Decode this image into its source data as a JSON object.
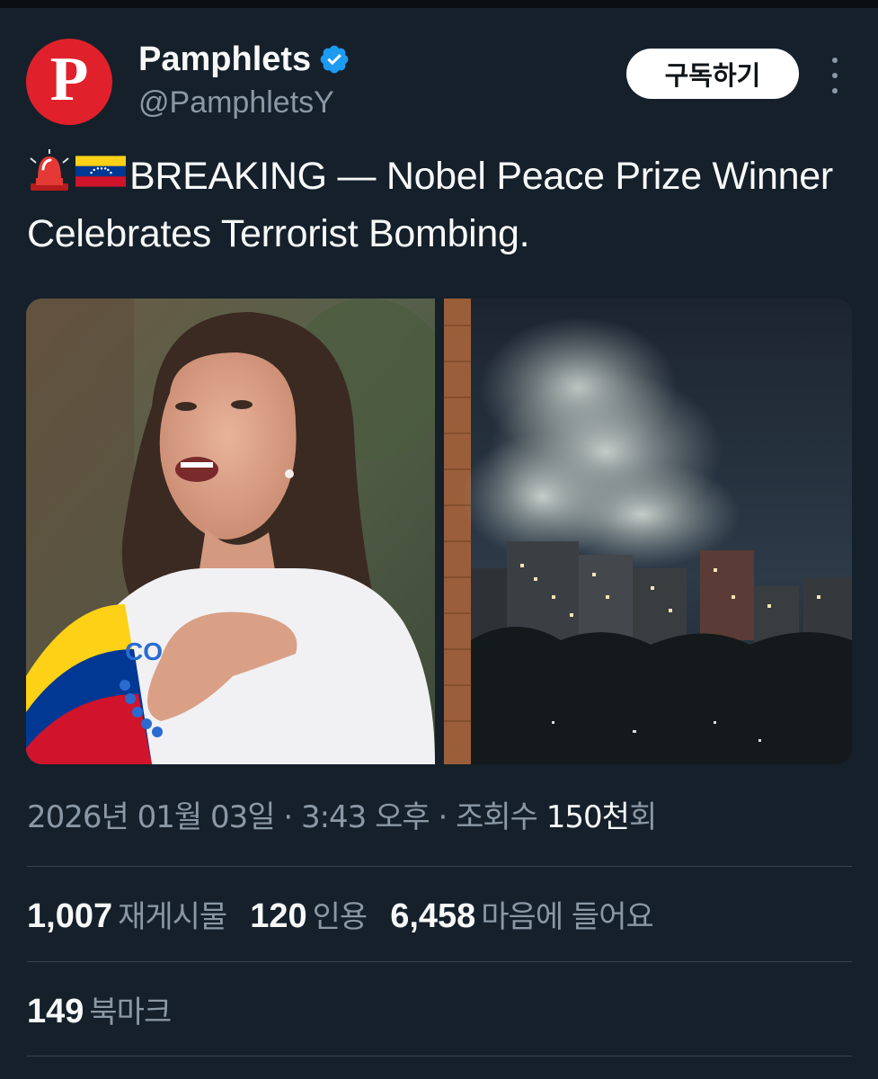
{
  "account": {
    "avatar_letter": "P",
    "avatar_color": "#e0202b",
    "display_name": "Pamphlets",
    "handle": "@PamphletsY",
    "verified_icon": "verified-badge-icon",
    "verified_color": "#1d9bf0"
  },
  "actions": {
    "subscribe_label": "구독하기",
    "more_icon": "more-vertical-icon"
  },
  "tweet": {
    "emojis": [
      "police-light-emoji",
      "venezuela-flag-emoji"
    ],
    "text": "BREAKING — Nobel Peace Prize Winner Celebrates Terrorist Bombing."
  },
  "media": [
    {
      "name": "woman-speaking-photo"
    },
    {
      "name": "night-city-smoke-photo"
    }
  ],
  "meta": {
    "date": "2026년 01월 03일",
    "sep1": " · ",
    "time": "3:43 오후",
    "sep2": " · ",
    "views_label": "조회수 ",
    "views_count": "150천",
    "views_suffix": "회"
  },
  "stats": {
    "reposts": {
      "count": "1,007",
      "label": "재게시물"
    },
    "quotes": {
      "count": "120",
      "label": "인용"
    },
    "likes": {
      "count": "6,458",
      "label": "마음에 들어요"
    },
    "bookmarks": {
      "count": "149",
      "label": "북마크"
    }
  },
  "colors": {
    "background": "#15202b",
    "text_primary": "#f7f9f9",
    "text_secondary": "#8b98a5",
    "divider": "#38444d"
  }
}
